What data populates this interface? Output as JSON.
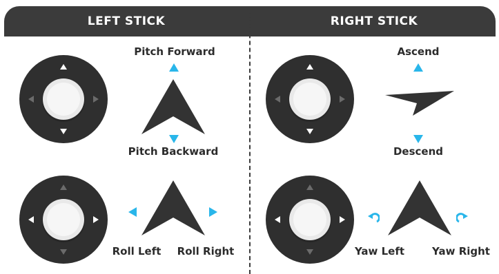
{
  "header": {
    "left_title": "LEFT STICK",
    "right_title": "RIGHT STICK"
  },
  "left_stick": {
    "top_control": {
      "highlighted_directions": [
        "up",
        "down"
      ],
      "up_label": "Pitch Forward",
      "down_label": "Pitch Backward",
      "icon": "plane-pitch-icon"
    },
    "bottom_control": {
      "highlighted_directions": [
        "left",
        "right"
      ],
      "left_label": "Roll Left",
      "right_label": "Roll Right",
      "icon": "plane-roll-icon"
    }
  },
  "right_stick": {
    "top_control": {
      "highlighted_directions": [
        "up",
        "down"
      ],
      "up_label": "Ascend",
      "down_label": "Descend",
      "icon": "plane-side-view-icon"
    },
    "bottom_control": {
      "highlighted_directions": [
        "left",
        "right"
      ],
      "left_label": "Yaw Left",
      "right_label": "Yaw Right",
      "icon": "plane-yaw-icon"
    }
  },
  "colors": {
    "header_bg": "#3b3b3b",
    "stick_base": "#2f2f2f",
    "arrow_active": "#ffffff",
    "arrow_inactive": "#6b6b6b",
    "indicator": "#29b6ea",
    "plane": "#333333",
    "label_text": "#2c2c2c"
  }
}
